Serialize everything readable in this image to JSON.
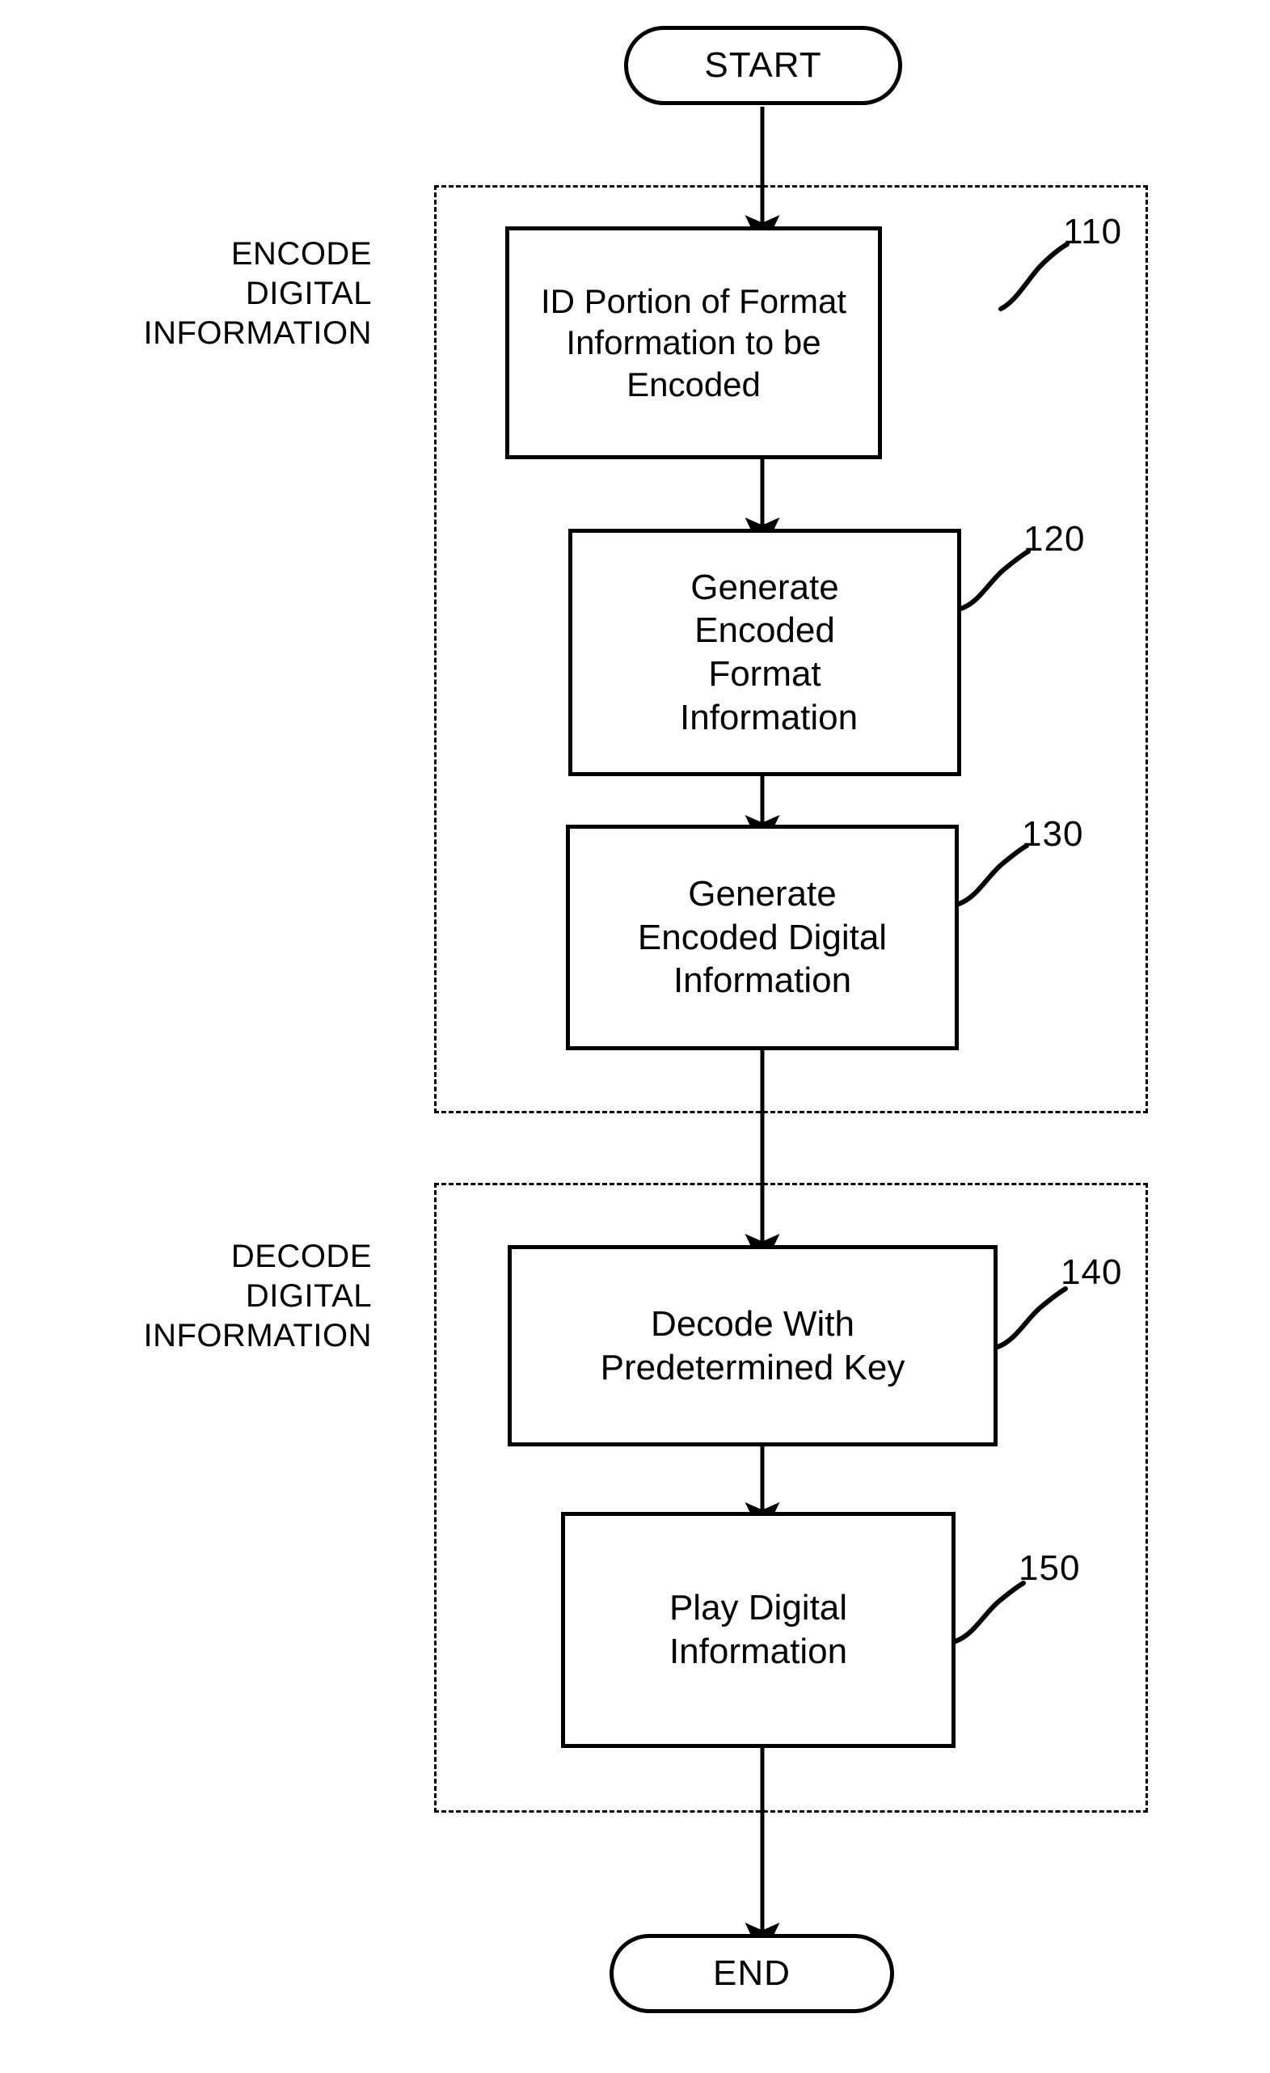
{
  "figure": {
    "type": "flowchart",
    "orientation": "vertical"
  },
  "terminals": {
    "start": "START",
    "end": "END"
  },
  "stages": [
    {
      "id": "encode",
      "label": "ENCODE\nDIGITAL\nINFORMATION"
    },
    {
      "id": "decode",
      "label": "DECODE\nDIGITAL\nINFORMATION"
    }
  ],
  "steps": [
    {
      "ref": "110",
      "text": "ID Portion of Format Information to be Encoded"
    },
    {
      "ref": "120",
      "text": "Generate Encoded Format Information"
    },
    {
      "ref": "130",
      "text": "Generate Encoded Digital Information"
    },
    {
      "ref": "140",
      "text": "Decode With Predetermined Key"
    },
    {
      "ref": "150",
      "text": "Play Digital Information"
    }
  ],
  "colors": {
    "stroke": "#000000",
    "background": "#ffffff"
  }
}
